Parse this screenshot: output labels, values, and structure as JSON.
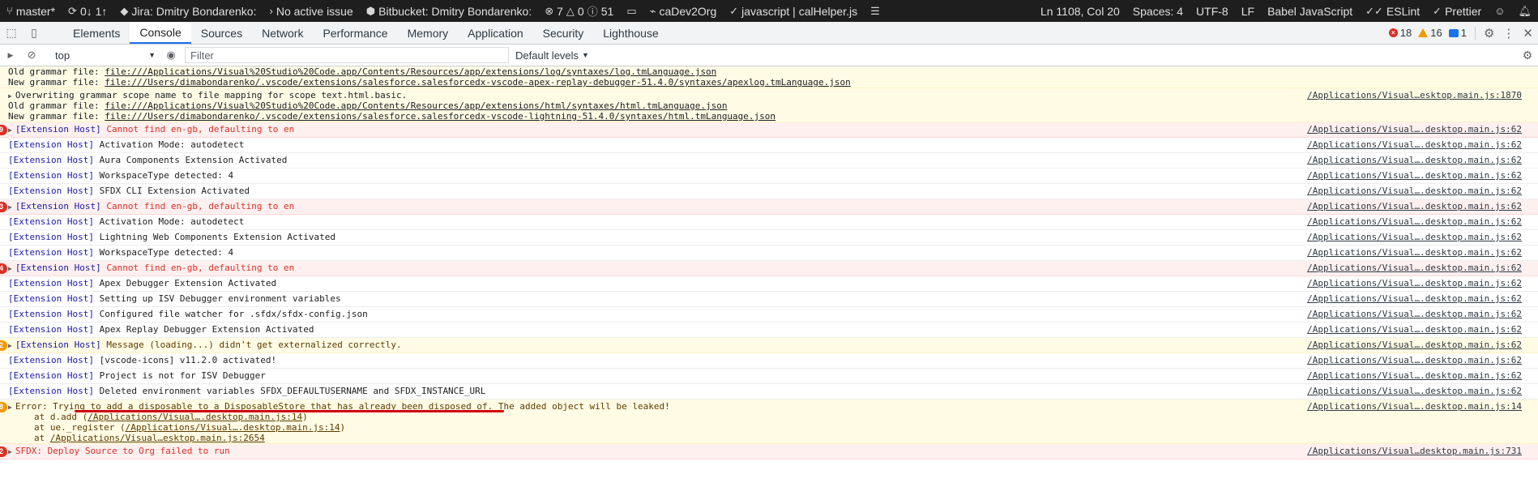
{
  "statusbar": {
    "branch": "master*",
    "sync": "0↓ 1↑",
    "jira": "Jira: Dmitry Bondarenko:",
    "issue": "No active issue",
    "bitbucket": "Bitbucket: Dmitry Bondarenko:",
    "problems": {
      "errors": "7",
      "warnings": "0",
      "info": "51"
    },
    "org": "caDev2Org",
    "file": "javascript | calHelper.js",
    "position": "Ln 1108, Col 20",
    "spaces": "Spaces: 4",
    "encoding": "UTF-8",
    "eol": "LF",
    "language": "Babel JavaScript",
    "eslint": "ESLint",
    "prettier": "Prettier"
  },
  "devtools": {
    "tabs": [
      "Elements",
      "Console",
      "Sources",
      "Network",
      "Performance",
      "Memory",
      "Application",
      "Security",
      "Lighthouse"
    ],
    "active_tab": "Console",
    "counts": {
      "errors": "18",
      "warnings": "16",
      "messages": "1"
    }
  },
  "toolbar": {
    "context": "top",
    "filter_placeholder": "Filter",
    "levels": "Default levels"
  },
  "log": {
    "grammar1": {
      "old_label": "Old grammar file:",
      "old_path": "file:///Applications/Visual%20Studio%20Code.app/Contents/Resources/app/extensions/log/syntaxes/log.tmLanguage.json",
      "new_label": "New grammar file:",
      "new_path": "file:///Users/dimabondarenko/.vscode/extensions/salesforce.salesforcedx-vscode-apex-replay-debugger-51.4.0/syntaxes/apexlog.tmLanguage.json"
    },
    "grammar2": {
      "message": "Overwriting grammar scope name to file mapping for scope text.html.basic.",
      "source": "/Applications/Visual…esktop.main.js:1870",
      "old_label": "Old grammar file:",
      "old_path": "file:///Applications/Visual%20Studio%20Code.app/Contents/Resources/app/extensions/html/syntaxes/html.tmLanguage.json",
      "new_label": "New grammar file:",
      "new_path": "file:///Users/dimabondarenko/.vscode/extensions/salesforce.salesforcedx-vscode-lightning-51.4.0/syntaxes/html.tmLanguage.json"
    },
    "prefix": "[Extension Host]",
    "source_default": "/Applications/Visual….desktop.main.js:62",
    "rows": [
      {
        "kind": "error",
        "badge": "9",
        "expand": true,
        "text": "Cannot find en-gb, defaulting to en"
      },
      {
        "kind": "info",
        "text": "Activation Mode: autodetect"
      },
      {
        "kind": "info",
        "text": "Aura Components Extension Activated"
      },
      {
        "kind": "info",
        "text": "WorkspaceType detected: 4"
      },
      {
        "kind": "info",
        "text": "SFDX CLI Extension Activated"
      },
      {
        "kind": "error",
        "badge": "3",
        "expand": true,
        "text": "Cannot find en-gb, defaulting to en"
      },
      {
        "kind": "info",
        "text": "Activation Mode: autodetect"
      },
      {
        "kind": "info",
        "text": "Lightning Web Components Extension Activated"
      },
      {
        "kind": "info",
        "text": "WorkspaceType detected: 4"
      },
      {
        "kind": "error",
        "badge": "4",
        "expand": true,
        "text": "Cannot find en-gb, defaulting to en"
      },
      {
        "kind": "info",
        "text": "Apex Debugger Extension Activated"
      },
      {
        "kind": "info",
        "text": "Setting up ISV Debugger environment variables"
      },
      {
        "kind": "info",
        "text": "Configured file watcher for .sfdx/sfdx-config.json"
      },
      {
        "kind": "info",
        "text": "Apex Replay Debugger Extension Activated"
      },
      {
        "kind": "warn",
        "badge": "2",
        "expand": true,
        "text": "Message (loading...) didn't get externalized correctly."
      },
      {
        "kind": "info",
        "text": "[vscode-icons] v11.2.0 activated!"
      },
      {
        "kind": "info",
        "text": "Project is not for ISV Debugger"
      },
      {
        "kind": "info",
        "text": "Deleted environment variables SFDX_DEFAULTUSERNAME and SFDX_INSTANCE_URL"
      }
    ],
    "disposable": {
      "badge": "8",
      "message": "Error: Trying to add a disposable to a DisposableStore that has already been disposed of. The added object will be leaked!",
      "source": "/Applications/Visual….desktop.main.js:14",
      "stack1_pre": "at d.add (",
      "stack1_link": "/Applications/Visual….desktop.main.js:14",
      "stack1_post": ")",
      "stack2_pre": "at ue._register (",
      "stack2_link": "/Applications/Visual….desktop.main.js:14",
      "stack2_post": ")",
      "stack3_pre": "at ",
      "stack3_link": "/Applications/Visual…esktop.main.js:2654"
    },
    "deploy": {
      "badge": "2",
      "message": "SFDX: Deploy Source to Org failed to run",
      "source": "/Applications/Visual…desktop.main.js:731"
    }
  }
}
